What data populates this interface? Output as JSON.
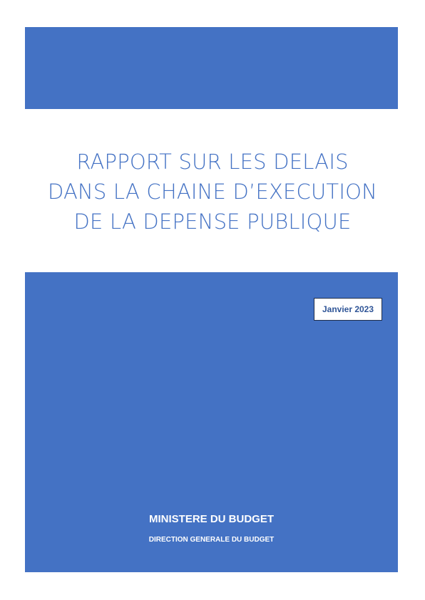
{
  "title": {
    "lines": [
      "RAPPORT SUR LES DELAIS",
      "DANS LA CHAINE D’EXECUTION",
      "DE LA DEPENSE PUBLIQUE"
    ]
  },
  "date_label": "Janvier 2023",
  "ministry": "MINISTERE DU BUDGET",
  "direction": "DIRECTION GENERALE DU BUDGET",
  "colors": {
    "accent": "#4472C4",
    "date_text": "#2F5597"
  }
}
